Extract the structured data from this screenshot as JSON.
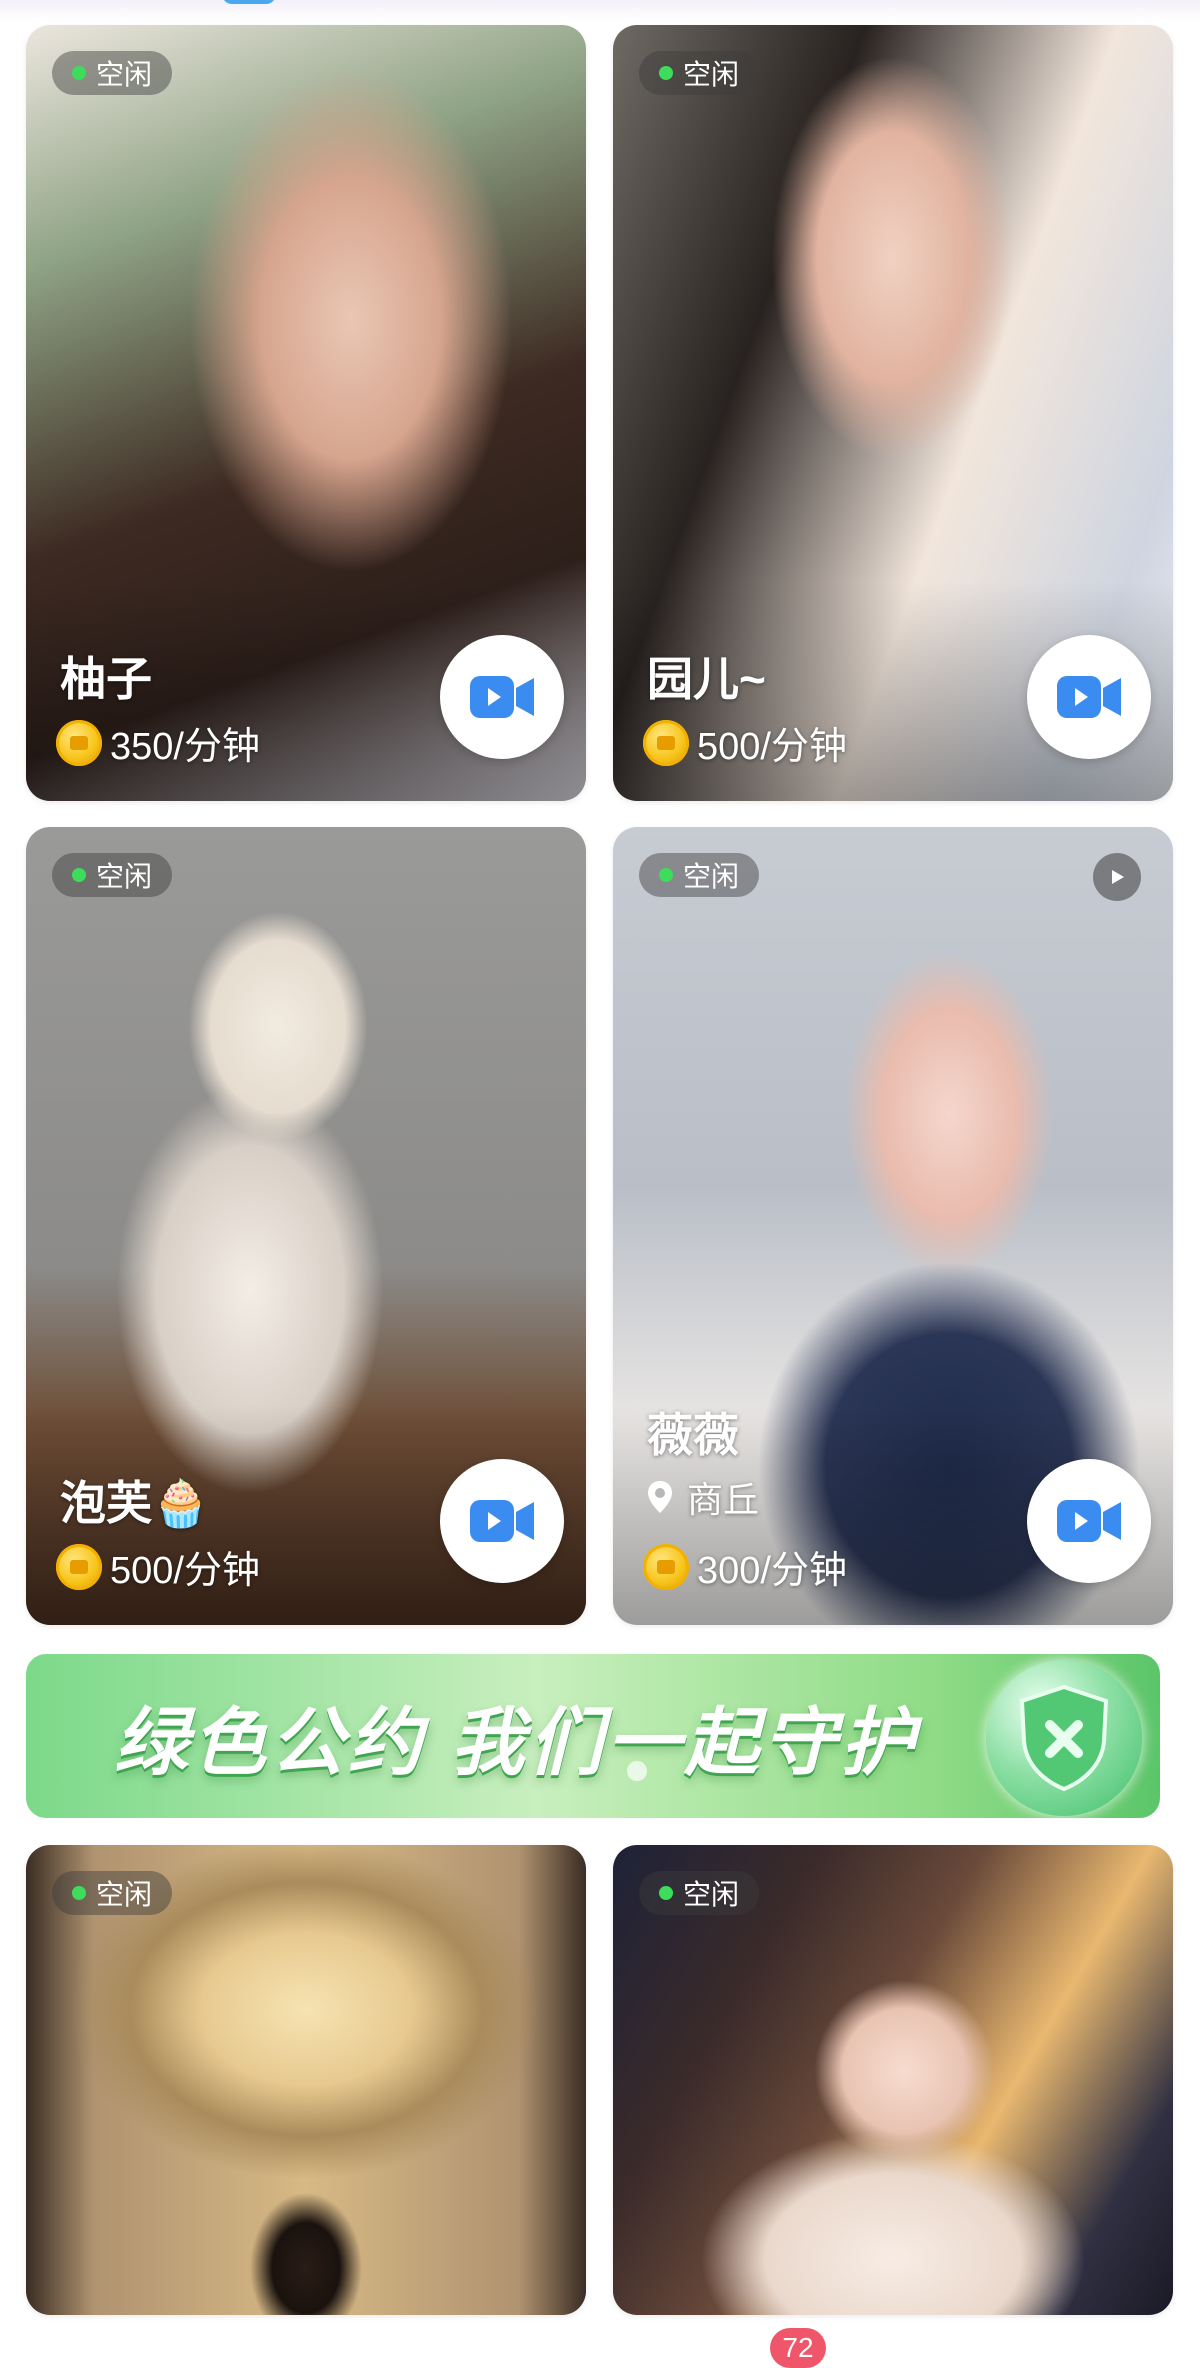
{
  "cards": [
    {
      "status": "空闲",
      "name": "柚子",
      "price": "350/分钟"
    },
    {
      "status": "空闲",
      "name": "园儿~",
      "price": "500/分钟"
    },
    {
      "status": "空闲",
      "name": "泡芙🧁",
      "price": "500/分钟"
    },
    {
      "status": "空闲",
      "name": "薇薇",
      "location": "商丘",
      "price": "300/分钟"
    },
    {
      "status": "空闲"
    },
    {
      "status": "空闲"
    }
  ],
  "banner": {
    "text": "绿色公约 我们一起守护"
  },
  "bottom_badge": "72",
  "colors": {
    "online": "#3ddc5a",
    "banner_green": "#5bc56a",
    "video_icon": "#3b8cf0",
    "coin": "#f7c41a",
    "badge": "#f0566a"
  },
  "icons": [
    "video-call-icon",
    "coin-icon",
    "location-pin-icon",
    "play-icon",
    "shield-icon"
  ]
}
